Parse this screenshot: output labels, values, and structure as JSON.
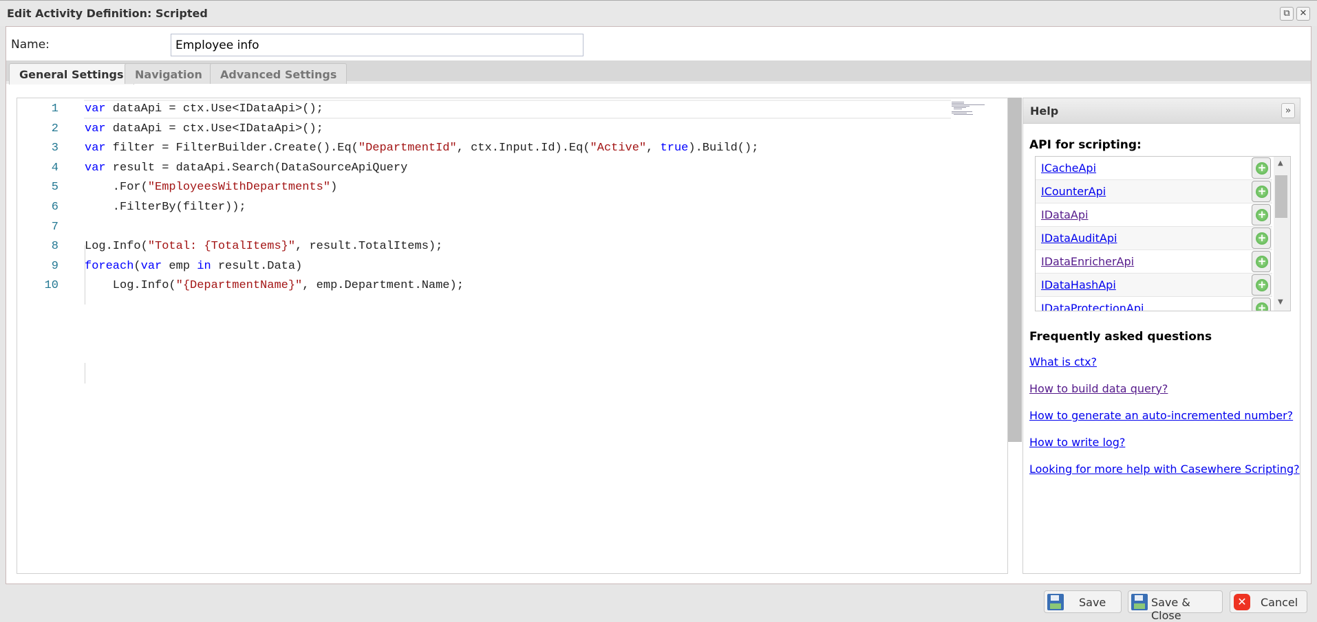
{
  "window": {
    "title": "Edit Activity Definition: Scripted",
    "restore_icon": "restore-icon",
    "close_icon": "close-icon"
  },
  "form": {
    "name_label": "Name:",
    "name_value": "Employee info"
  },
  "tabs": [
    {
      "label": "General Settings",
      "active": true
    },
    {
      "label": "Navigation"
    },
    {
      "label": "Advanced Settings"
    }
  ],
  "editor": {
    "lines": [
      {
        "n": "1",
        "html": "<span class='kw'>var</span> dataApi = ctx.Use&lt;IDataApi&gt;();"
      },
      {
        "n": "2",
        "html": "<span class='kw'>var</span> dataApi = ctx.Use&lt;IDataApi&gt;();"
      },
      {
        "n": "3",
        "html": "<span class='kw'>var</span> filter = FilterBuilder.Create().Eq(<span class='str'>\"DepartmentId\"</span>, ctx.Input.Id).Eq(<span class='str'>\"Active\"</span>, <span class='kw'>true</span>).Build();"
      },
      {
        "n": "4",
        "html": "<span class='kw'>var</span> result = dataApi.Search(DataSourceApiQuery"
      },
      {
        "n": "5",
        "html": "    .For(<span class='str'>\"EmployeesWithDepartments\"</span>)"
      },
      {
        "n": "6",
        "html": "    .FilterBy(filter));"
      },
      {
        "n": "7",
        "html": ""
      },
      {
        "n": "8",
        "html": "Log.Info(<span class='str'>\"Total: {TotalItems}\"</span>, result.TotalItems);"
      },
      {
        "n": "9",
        "html": "<span class='kw'>foreach</span>(<span class='kw'>var</span> emp <span class='kw'>in</span> result.Data)"
      },
      {
        "n": "10",
        "html": "    Log.Info(<span class='str'>\"{DepartmentName}\"</span>, emp.Department.Name);"
      }
    ]
  },
  "help": {
    "title": "Help",
    "api_heading": "API for scripting:",
    "apis": [
      {
        "label": "ICacheApi"
      },
      {
        "label": "ICounterApi"
      },
      {
        "label": "IDataApi",
        "visited": true
      },
      {
        "label": "IDataAuditApi"
      },
      {
        "label": "IDataEnricherApi",
        "visited": true
      },
      {
        "label": "IDataHashApi"
      },
      {
        "label": "IDataProtectionApi"
      }
    ],
    "faq_heading": "Frequently asked questions",
    "faq": [
      {
        "label": "What is ctx?"
      },
      {
        "label": "How to build data query?",
        "visited": true
      },
      {
        "label": "How to generate an auto-incremented number?"
      },
      {
        "label": "How to write log?"
      },
      {
        "label": "Looking for more help with Casewhere Scripting?"
      }
    ]
  },
  "buttons": {
    "save": "Save",
    "save_close": "Save & Close",
    "cancel": "Cancel"
  }
}
